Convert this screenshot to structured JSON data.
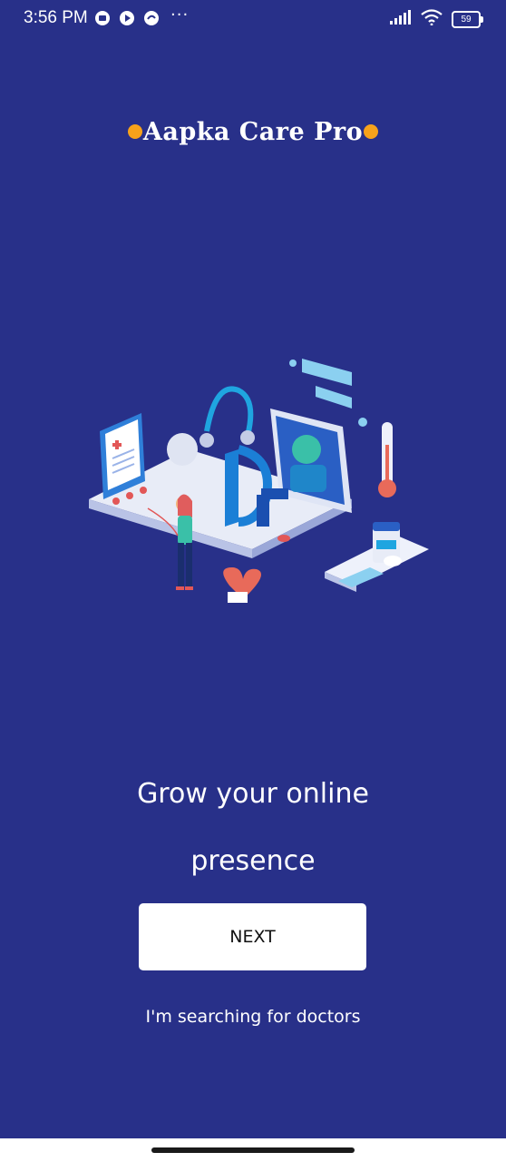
{
  "status_bar": {
    "time": "3:56 PM",
    "dots": "···",
    "battery": "59"
  },
  "brand": {
    "name": "Aapka Care Pro",
    "dot_color": "#f7a21b"
  },
  "headline": {
    "line1": "Grow your online",
    "line2": "presence"
  },
  "next_button": {
    "label": "NEXT"
  },
  "search_link": {
    "label": "I'm searching for doctors"
  },
  "colors": {
    "background": "#283089",
    "accent": "#f7a21b",
    "button": "#ffffff"
  }
}
